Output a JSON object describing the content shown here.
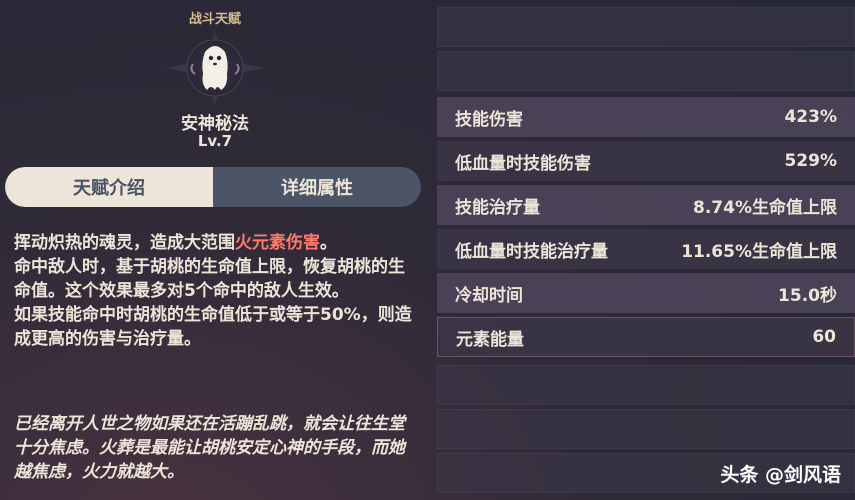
{
  "talent": {
    "category": "战斗天赋",
    "name": "安神秘法",
    "level": "Lv.7",
    "emblem_icon": "ghost-icon"
  },
  "tabs": [
    {
      "label": "天赋介绍",
      "active": true
    },
    {
      "label": "详细属性",
      "active": false
    }
  ],
  "description": {
    "line1_prefix": "挥动炽热的魂灵，造成大范围",
    "line1_highlight": "火元素伤害",
    "line1_suffix": "。",
    "body": "命中敌人时，基于胡桃的生命值上限，恢复胡桃的生命值。这个效果最多对5个命中的敌人生效。\n如果技能命中时胡桃的生命值低于或等于50%，则造成更高的伤害与治疗量。",
    "highlight_color": "#ff7a6a"
  },
  "flavor_text": "已经离开人世之物如果还在活蹦乱跳，就会让往生堂十分焦虑。火葬是最能让胡桃安定心神的手段，而她越焦虑，火力就越大。",
  "stats": [
    {
      "label": "技能伤害",
      "value": "423%"
    },
    {
      "label": "低血量时技能伤害",
      "value": "529%"
    },
    {
      "label": "技能治疗量",
      "value": "8.74%生命值上限"
    },
    {
      "label": "低血量时技能治疗量",
      "value": "11.65%生命值上限"
    },
    {
      "label": "冷却时间",
      "value": "15.0秒"
    },
    {
      "label": "元素能量",
      "value": "60"
    }
  ],
  "watermark": "头条 @剑风语"
}
